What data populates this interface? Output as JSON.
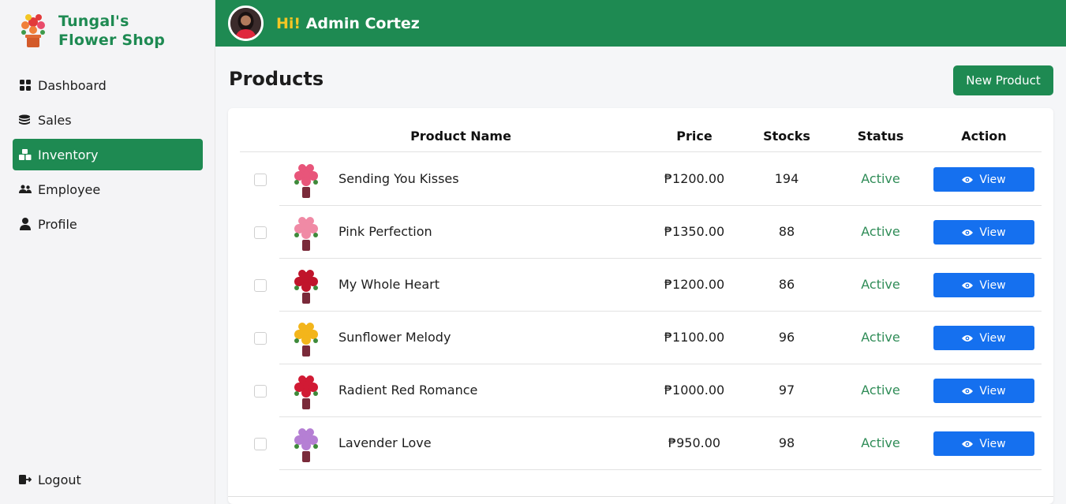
{
  "brand": {
    "line1": "Tungal's",
    "line2": "Flower Shop"
  },
  "sidebar": {
    "items": [
      {
        "label": "Dashboard",
        "icon": "grid-icon",
        "active": false
      },
      {
        "label": "Sales",
        "icon": "coins-icon",
        "active": false
      },
      {
        "label": "Inventory",
        "icon": "boxes-icon",
        "active": true
      },
      {
        "label": "Employee",
        "icon": "users-icon",
        "active": false
      },
      {
        "label": "Profile",
        "icon": "user-icon",
        "active": false
      }
    ],
    "logout": "Logout"
  },
  "header": {
    "hi": "Hi!",
    "name": "Admin Cortez"
  },
  "main": {
    "title": "Products",
    "new_button": "New Product",
    "columns": {
      "name": "Product Name",
      "price": "Price",
      "stocks": "Stocks",
      "status": "Status",
      "action": "Action"
    },
    "view_label": "View",
    "products": [
      {
        "name": "Sending You Kisses",
        "price": "₱1200.00",
        "stocks": "194",
        "status": "Active",
        "flower": "#e8557a"
      },
      {
        "name": "Pink Perfection",
        "price": "₱1350.00",
        "stocks": "88",
        "status": "Active",
        "flower": "#f08aa5"
      },
      {
        "name": "My Whole Heart",
        "price": "₱1200.00",
        "stocks": "86",
        "status": "Active",
        "flower": "#c0142b"
      },
      {
        "name": "Sunflower Melody",
        "price": "₱1100.00",
        "stocks": "96",
        "status": "Active",
        "flower": "#f3b51b"
      },
      {
        "name": "Radient Red Romance",
        "price": "₱1000.00",
        "stocks": "97",
        "status": "Active",
        "flower": "#d11a34"
      },
      {
        "name": "Lavender Love",
        "price": "₱950.00",
        "stocks": "98",
        "status": "Active",
        "flower": "#b57fd4"
      }
    ]
  },
  "colors": {
    "brand_green": "#1e8a52",
    "accent_yellow": "#f3c624",
    "view_blue": "#1570ef",
    "status_green": "#2f8c57"
  }
}
